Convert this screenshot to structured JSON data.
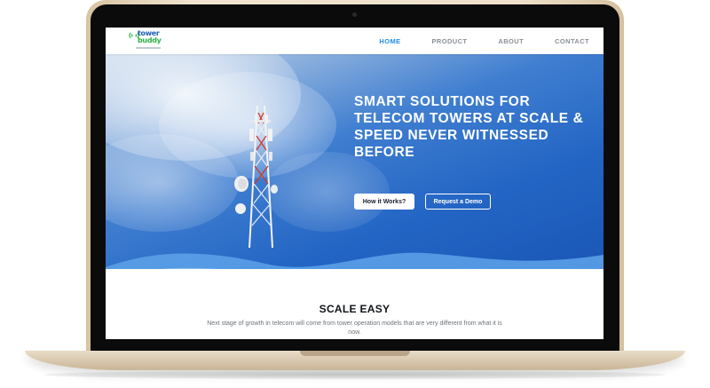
{
  "brand": {
    "name_line1": "tower",
    "name_line2": "buddy",
    "colors": {
      "primary_blue": "#1b5fb3",
      "primary_green": "#2db34a",
      "accent_nav": "#1f8ee6"
    }
  },
  "nav": {
    "items": [
      {
        "label": "HOME",
        "active": true
      },
      {
        "label": "PRODUCT",
        "active": false
      },
      {
        "label": "ABOUT",
        "active": false
      },
      {
        "label": "CONTACT",
        "active": false
      }
    ]
  },
  "hero": {
    "headline": "SMART SOLUTIONS FOR TELECOM TOWERS AT SCALE & SPEED NEVER WITNESSED BEFORE",
    "primary_cta": "How it Works?",
    "secondary_cta": "Request a Demo",
    "image_subject": "telecom-tower"
  },
  "section": {
    "title": "SCALE EASY",
    "body": "Next stage of growth in telecom will come from tower operation models that are very different from what it is now."
  },
  "device": {
    "frame": "laptop-gold",
    "icons": [
      "camera-icon",
      "tower-logo-icon"
    ]
  }
}
